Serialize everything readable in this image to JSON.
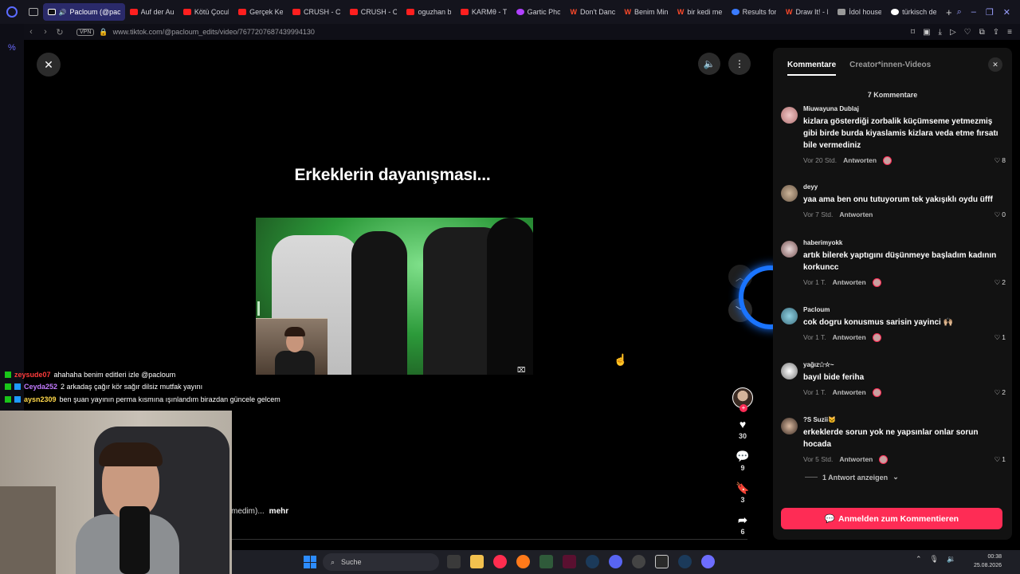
{
  "tabs": [
    {
      "label": "Pacloum (@pac",
      "icon": "tiktok-icon",
      "active": true
    },
    {
      "label": "Auf der Au",
      "icon": "youtube-icon"
    },
    {
      "label": "Kötü Çocul",
      "icon": "youtube-icon"
    },
    {
      "label": "Gerçek Ke",
      "icon": "youtube-icon"
    },
    {
      "label": "CRUSH - C",
      "icon": "youtube-icon"
    },
    {
      "label": "CRUSH - C",
      "icon": "youtube-icon"
    },
    {
      "label": "oguzhan b",
      "icon": "youtube-icon"
    },
    {
      "label": "KARMθ - T",
      "icon": "youtube-icon"
    },
    {
      "label": "Gartic Pho",
      "icon": "gartic-icon"
    },
    {
      "label": "Don't Danc",
      "icon": "w-icon"
    },
    {
      "label": "Benim Min",
      "icon": "w-icon"
    },
    {
      "label": "bir kedi me",
      "icon": "w-icon"
    },
    {
      "label": "Results for",
      "icon": "globe-icon"
    },
    {
      "label": "Draw It! - I",
      "icon": "w-icon"
    },
    {
      "label": "İdol house",
      "icon": "house-icon"
    },
    {
      "label": "türkisch de",
      "icon": "google-icon"
    }
  ],
  "address": {
    "vpn": "VPN",
    "url": "www.tiktok.com/@pacloum_edits/video/7677207687439994130"
  },
  "video": {
    "caption": "Erkeklerin dayanışması...",
    "description_tail": "medim)...",
    "more_label": "mehr"
  },
  "actions": {
    "likes": "30",
    "comments": "9",
    "saves": "3",
    "shares": "6"
  },
  "chat": [
    {
      "user": "zeysude07",
      "user_color": "#ff3b3b",
      "badge": "green",
      "message": "ahahaha benim editleri izle @pacloum"
    },
    {
      "user": "Ceyda252",
      "user_color": "#c37bff",
      "badge": "green-blue",
      "message": "2 arkadaş çağır kör sağır dilsiz mutfak yayını"
    },
    {
      "user": "aysn2309",
      "user_color": "#ffd84a",
      "badge": "green-blue",
      "message": "ben şuan yayının perma kısmına ışınlandım birazdan güncele gelcem"
    }
  ],
  "panel": {
    "tab_comments": "Kommentare",
    "tab_creator": "Creator*innen-Videos",
    "count": "7 Kommentare",
    "reply_label": "Antworten",
    "show_replies": "1 Antwort anzeigen",
    "login_label": "Anmelden zum Kommentieren"
  },
  "comments": [
    {
      "user": "Miuwayuna Dublaj",
      "text": "kizlara gösterdiği zorbalik küçümseme yetmezmiş gibi birde burda kiyaslamis kizlara veda etme fırsatı bile vermediniz",
      "time": "Vor 20 Std.",
      "likes": "8",
      "creator_liked": true
    },
    {
      "user": "deyy",
      "text": "yaa ama ben onu tutuyorum tek yakışıklı oydu üfff",
      "time": "Vor 7 Std.",
      "likes": "0",
      "creator_liked": false
    },
    {
      "user": "haberimyokk",
      "text": "artık bilerek yaptıgını düşünmeye başladım kadının korkuncc",
      "time": "Vor 1 T.",
      "likes": "2",
      "creator_liked": true
    },
    {
      "user": "Pacloum",
      "text": "cok dogru konusmus sarisin yayinci 🙌🏼",
      "time": "Vor 1 T.",
      "likes": "1",
      "creator_liked": true
    },
    {
      "user": "yağız✩☆~",
      "text": "bayıl bide feriha",
      "time": "Vor 1 T.",
      "likes": "2",
      "creator_liked": true
    },
    {
      "user": "?S Suzii🐱",
      "text": "erkeklerde sorun yok ne yapsınlar onlar sorun hocada",
      "time": "Vor 5 Std.",
      "likes": "1",
      "creator_liked": true
    }
  ],
  "taskbar": {
    "search_placeholder": "Suche",
    "time": "00:38",
    "date": "25.08.2026"
  },
  "colors": {
    "tiktok_red": "#fe2c55",
    "browser_accent": "#5b6bff",
    "cursor_ring": "#1a74ff"
  }
}
